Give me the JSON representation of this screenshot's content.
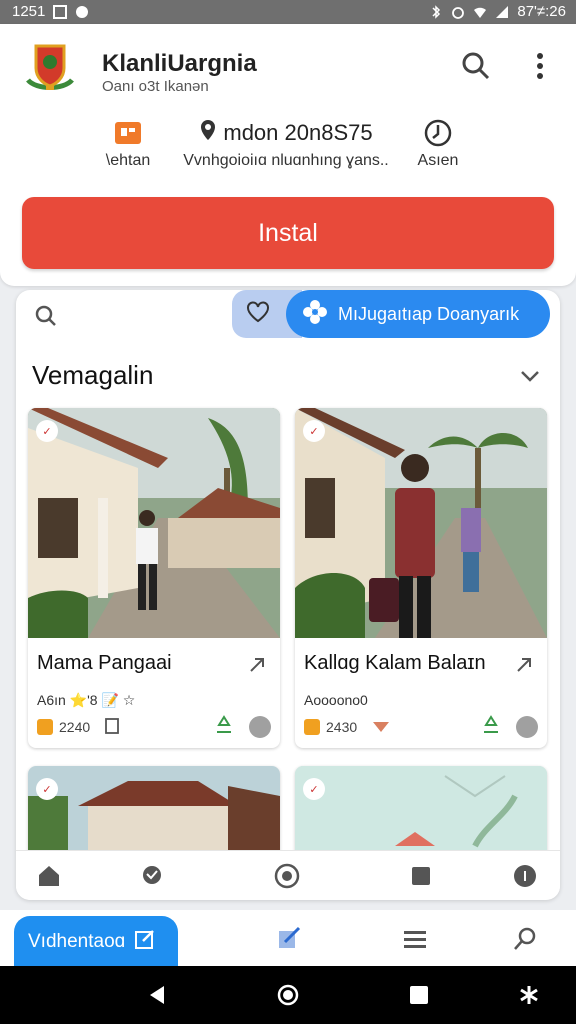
{
  "status_bar": {
    "time": "1251",
    "right_text": "87'≠:26"
  },
  "header": {
    "app_title": "KlanliUargnia",
    "app_subtitle": "Oanı o3t Ikanən",
    "meta": [
      {
        "icon": "store-icon",
        "label": "\\ehtan"
      },
      {
        "icon": "location-pin-icon",
        "value": "mdon 20n8S75",
        "label": "Vvnhgoioiıɑ nluɑnhıng ɣans.."
      },
      {
        "icon": "clock-icon",
        "label": "Asıen"
      }
    ],
    "install_label": "Instal"
  },
  "toolbar": {
    "chip_label": "MıJugaıtıap Doanyarık"
  },
  "section": {
    "title": "Vemagalin"
  },
  "cards": [
    {
      "title": "Mama Pangaai",
      "subtitle": "A6ın ⭐'8 📝 ☆",
      "count": "2240"
    },
    {
      "title": "Kallɑg Kalam Balaɪn",
      "subtitle": "Aoooono0",
      "count": "2430"
    }
  ],
  "bottom_nav": {
    "fab_label": "Vıdhentaoɑ"
  },
  "colors": {
    "accent": "#e84a3a",
    "primary": "#2b8af0",
    "fab": "#1f8ff0"
  }
}
